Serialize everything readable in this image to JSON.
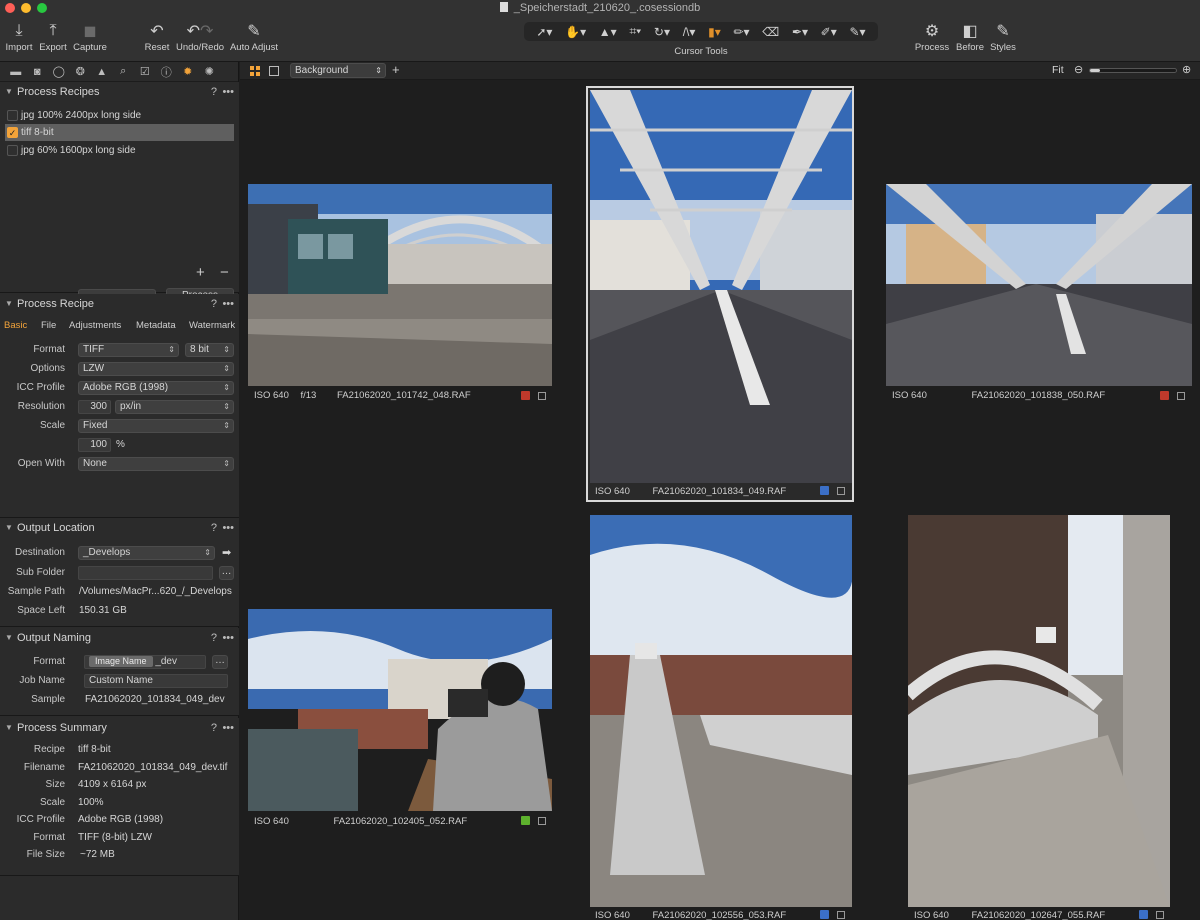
{
  "window": {
    "title": "_Speicherstadt_210620_.cosessiondb"
  },
  "toolbar": {
    "import": "Import",
    "export": "Export",
    "capture": "Capture",
    "reset": "Reset",
    "undo_redo": "Undo/Redo",
    "auto_adjust": "Auto Adjust",
    "cursor_tools": "Cursor Tools",
    "process": "Process",
    "before": "Before",
    "styles": "Styles"
  },
  "process_recipes": {
    "title": "Process Recipes",
    "help": "?",
    "more": "•••",
    "items": [
      {
        "label": "jpg 100% 2400px long side",
        "checked": false
      },
      {
        "label": "tiff 8-bit",
        "checked": true
      },
      {
        "label": "jpg 60% 1600px long side",
        "checked": false
      }
    ],
    "process_button": "Process"
  },
  "process_recipe": {
    "title": "Process Recipe",
    "tabs": [
      "Basic",
      "File",
      "Adjustments",
      "Metadata",
      "Watermark"
    ],
    "format_label": "Format",
    "format_value": "TIFF",
    "bit_value": "8 bit",
    "options_label": "Options",
    "options_value": "LZW",
    "icc_label": "ICC Profile",
    "icc_value": "Adobe RGB (1998)",
    "resolution_label": "Resolution",
    "resolution_value": "300",
    "resolution_unit": "px/in",
    "scale_label": "Scale",
    "scale_value": "Fixed",
    "scale_percent": "100",
    "percent_sign": "%",
    "open_with_label": "Open With",
    "open_with_value": "None"
  },
  "output_location": {
    "title": "Output Location",
    "destination_label": "Destination",
    "destination_value": "_Develops",
    "subfolder_label": "Sub Folder",
    "subfolder_value": "",
    "sample_path_label": "Sample Path",
    "sample_path_value": "/Volumes/MacPr...620_/_Develops",
    "space_left_label": "Space Left",
    "space_left_value": "150.31 GB"
  },
  "output_naming": {
    "title": "Output Naming",
    "format_label": "Format",
    "format_token": "Image Name",
    "format_suffix": "_dev",
    "job_name_label": "Job Name",
    "job_name_value": "Custom Name",
    "sample_label": "Sample",
    "sample_value": "FA21062020_101834_049_dev"
  },
  "process_summary": {
    "title": "Process Summary",
    "rows": [
      {
        "label": "Recipe",
        "value": "tiff 8-bit"
      },
      {
        "label": "Filename",
        "value": "FA21062020_101834_049_dev.tif"
      },
      {
        "label": "Size",
        "value": "4109 x 6164 px"
      },
      {
        "label": "Scale",
        "value": "100%"
      },
      {
        "label": "ICC Profile",
        "value": "Adobe RGB (1998)"
      },
      {
        "label": "Format",
        "value": "TIFF (8-bit) LZW"
      },
      {
        "label": "File Size",
        "value": "~72 MB"
      }
    ]
  },
  "browser": {
    "background_label": "Background",
    "fit_label": "Fit",
    "thumbnails": [
      {
        "iso": "ISO 640",
        "aperture": "f/13",
        "file": "FA21062020_101742_048.RAF",
        "color": "#c0392b"
      },
      {
        "iso": "ISO 640",
        "aperture": "",
        "file": "FA21062020_101834_049.RAF",
        "color": "#3b6fc7"
      },
      {
        "iso": "ISO 640",
        "aperture": "",
        "file": "FA21062020_101838_050.RAF",
        "color": "#c0392b"
      },
      {
        "iso": "ISO 640",
        "aperture": "",
        "file": "FA21062020_102405_052.RAF",
        "color": "#5db12d"
      },
      {
        "iso": "ISO 640",
        "aperture": "",
        "file": "FA21062020_102556_053.RAF",
        "color": "#3b6fc7"
      },
      {
        "iso": "ISO 640",
        "aperture": "",
        "file": "FA21062020_102647_055.RAF",
        "color": "#3b6fc7"
      }
    ]
  }
}
